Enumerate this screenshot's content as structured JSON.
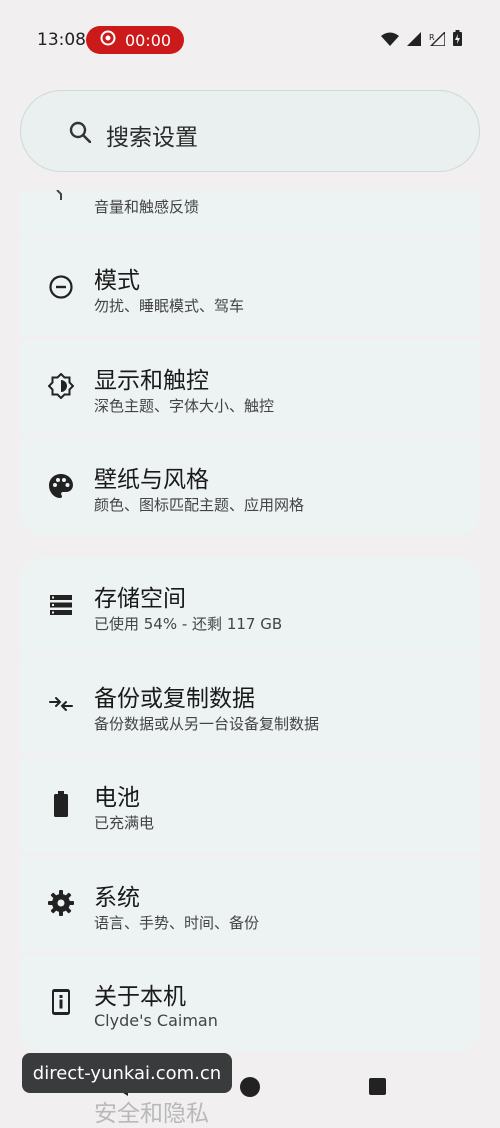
{
  "status_bar": {
    "time": "13:08",
    "recording_timer": "00:00"
  },
  "search": {
    "placeholder": "搜索设置"
  },
  "items": [
    {
      "title": "",
      "subtitle": "音量和触感反馈",
      "icon": "volume-icon"
    },
    {
      "title": "模式",
      "subtitle": "勿扰、睡眠模式、驾车",
      "icon": "do-not-disturb-icon"
    },
    {
      "title": "显示和触控",
      "subtitle": "深色主题、字体大小、触控",
      "icon": "brightness-icon"
    },
    {
      "title": "壁纸与风格",
      "subtitle": "颜色、图标匹配主题、应用网格",
      "icon": "palette-icon"
    },
    {
      "title": "存储空间",
      "subtitle": "已使用 54% - 还剩 117 GB",
      "icon": "storage-icon"
    },
    {
      "title": "备份或复制数据",
      "subtitle": "备份数据或从另一台设备复制数据",
      "icon": "backup-icon"
    },
    {
      "title": "电池",
      "subtitle": "已充满电",
      "icon": "battery-icon"
    },
    {
      "title": "系统",
      "subtitle": "语言、手势、时间、备份",
      "icon": "gear-icon"
    },
    {
      "title": "关于本机",
      "subtitle": "Clyde's Caiman",
      "icon": "phone-info-icon"
    }
  ],
  "peek_item": {
    "title": "安全和隐私"
  },
  "toast": {
    "text": "direct-yunkai.com.cn"
  }
}
